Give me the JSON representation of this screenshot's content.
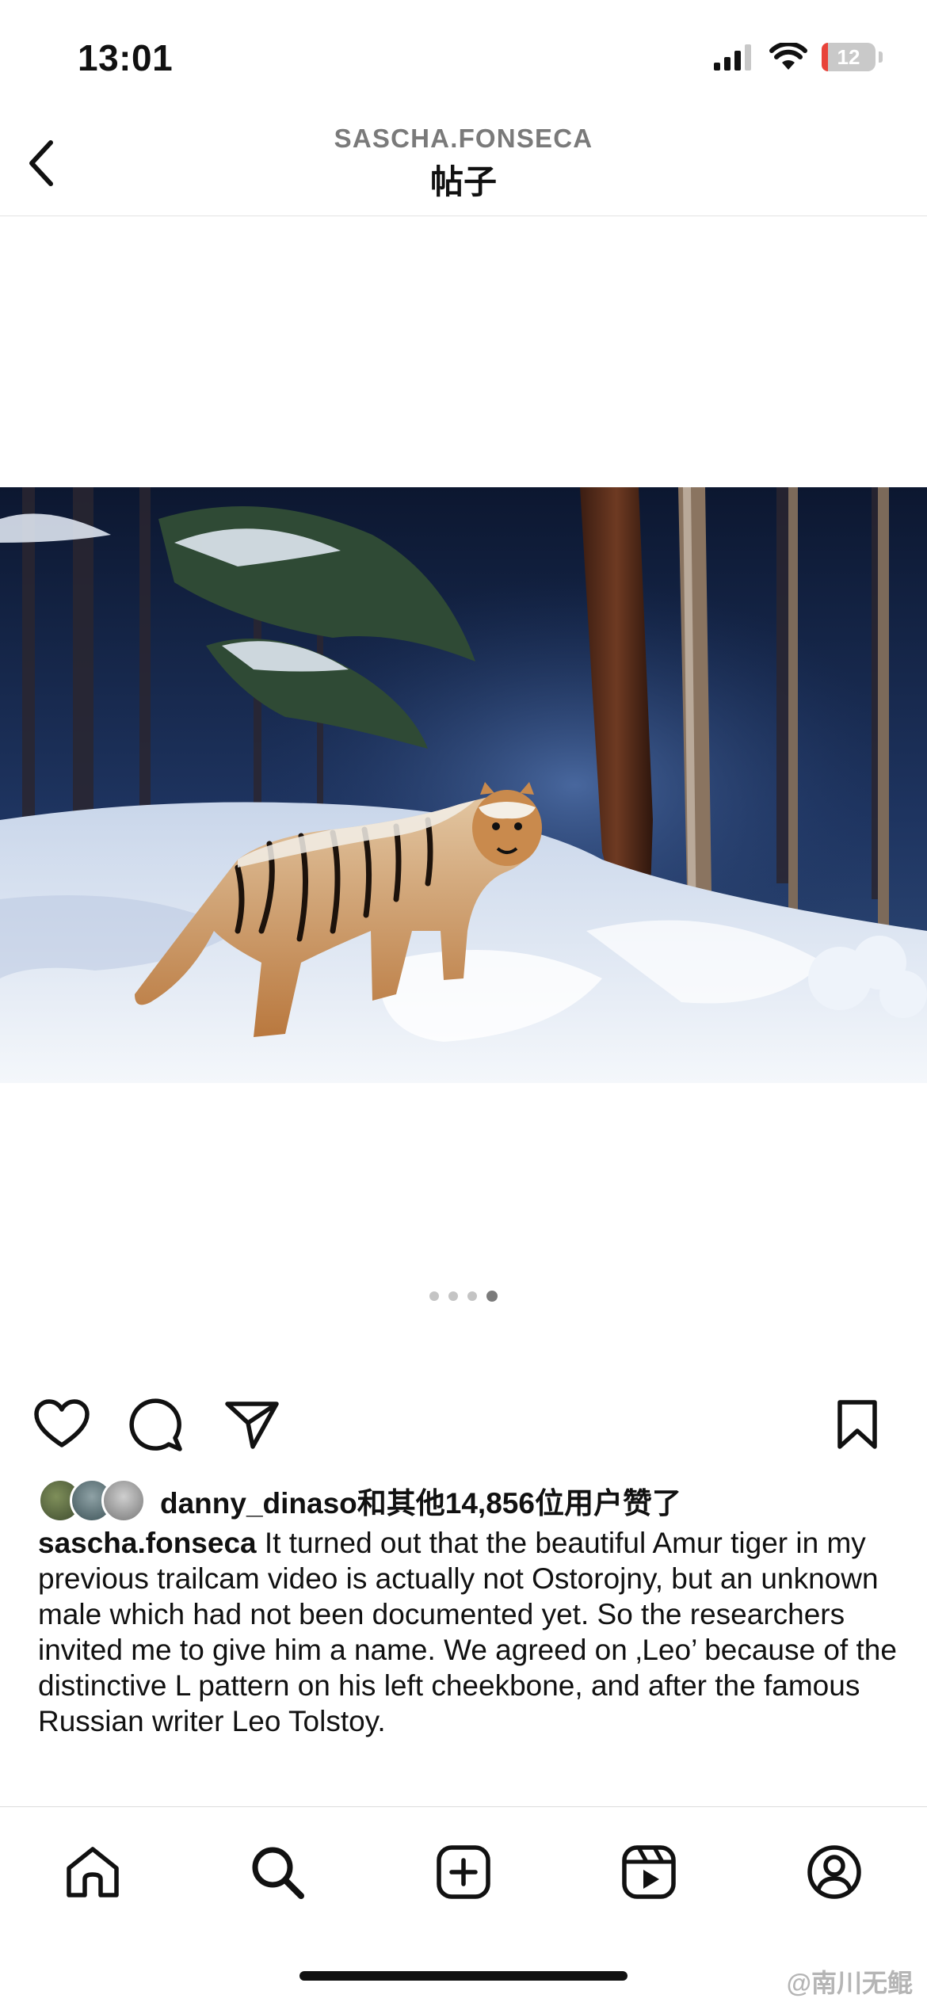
{
  "status_bar": {
    "time": "13:01",
    "battery": "12",
    "battery_level": 0.12
  },
  "header": {
    "username": "SASCHA.FONSECA",
    "title": "帖子"
  },
  "post": {
    "carousel": {
      "count": 4,
      "active_index": 3
    },
    "likes": {
      "liker": "danny_dinaso",
      "text": "和其他14,856位用户赞了"
    },
    "caption": {
      "user": "sascha.fonseca",
      "text": "It turned out that the beautiful Amur tiger in my previous trailcam video is actually not Ostorojny, but an unknown male which had not been documented yet. So the researchers invited me to give him a name. We agreed on ‚Leo’ because of the distinctive L pattern on his left cheekbone, and after the famous Russian writer Leo Tolstoy."
    }
  },
  "actions": [
    "heart-icon",
    "comment-icon",
    "share-icon",
    "bookmark-icon"
  ],
  "tab_bar": [
    "home-icon",
    "search-icon",
    "create-icon",
    "reels-icon",
    "profile-icon"
  ],
  "watermark": "@南川无鲲",
  "colors": {
    "battery_low": "#e8433a",
    "text": "#111111",
    "muted": "#7a7a7a"
  }
}
